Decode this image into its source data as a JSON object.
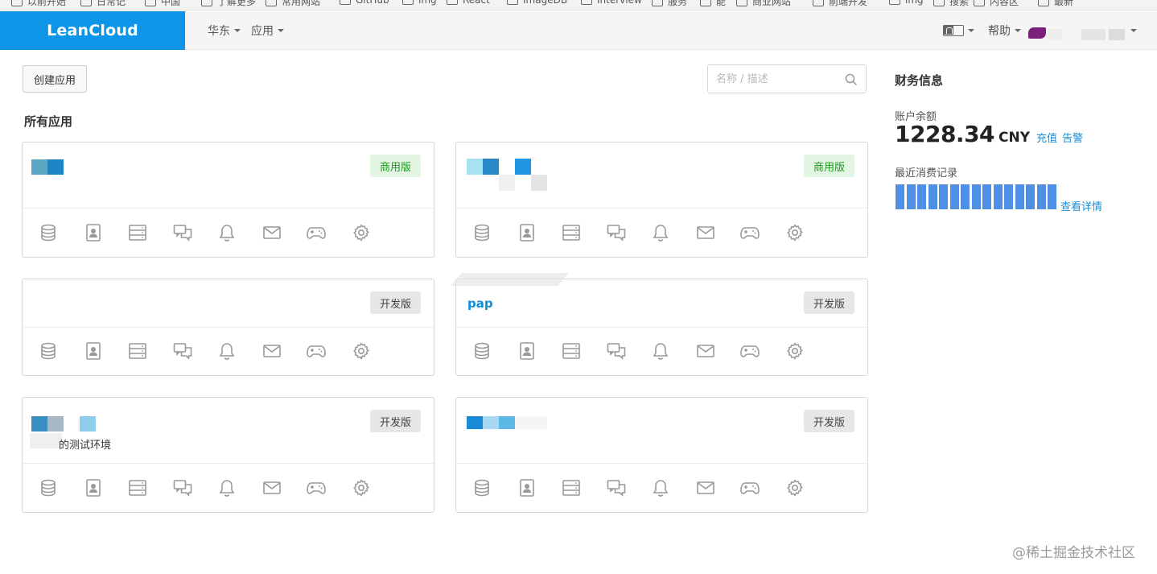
{
  "bookmarks": [
    {
      "label": "以前开始"
    },
    {
      "label": "日常记"
    },
    {
      "label": "中国"
    },
    {
      "label": "了解更多"
    },
    {
      "label": "常用网站"
    },
    {
      "label": "GitHub"
    },
    {
      "label": "img"
    },
    {
      "label": "React"
    },
    {
      "label": "ImageDB"
    },
    {
      "label": "Interview"
    },
    {
      "label": "服务"
    },
    {
      "label": "能"
    },
    {
      "label": "商业网站"
    },
    {
      "label": "前端开发"
    },
    {
      "label": "img"
    },
    {
      "label": "搜索"
    },
    {
      "label": "内容区"
    },
    {
      "label": "最新"
    }
  ],
  "header": {
    "logo": "LeanCloud",
    "region": "华东",
    "apps_menu": "应用",
    "help": "帮助",
    "lang_icon": "translate-icon"
  },
  "toolbar": {
    "create_label": "创建应用",
    "search_placeholder": "名称 / 描述"
  },
  "section_title": "所有应用",
  "cards": [
    {
      "badge": "商用版",
      "badge_type": "biz",
      "name": ""
    },
    {
      "badge": "商用版",
      "badge_type": "biz",
      "name": ""
    },
    {
      "badge": "开发版",
      "badge_type": "dev",
      "name": ""
    },
    {
      "badge": "开发版",
      "badge_type": "dev",
      "name": "pap"
    },
    {
      "badge": "开发版",
      "badge_type": "dev",
      "name": "的测试环境"
    },
    {
      "badge": "开发版",
      "badge_type": "dev",
      "name": ""
    }
  ],
  "card_icons": [
    "database-icon",
    "contact-card-icon",
    "server-icon",
    "chat-icon",
    "bell-icon",
    "mail-icon",
    "gamepad-icon",
    "gear-icon"
  ],
  "finance": {
    "title": "财务信息",
    "balance_label": "账户余额",
    "balance": "1228.34",
    "currency": "CNY",
    "recharge": "充值",
    "alert": "告警",
    "recent_label": "最近消费记录",
    "detail_link": "查看详情",
    "bar_color": "#4f8fe6",
    "bar_levels": [
      1,
      1,
      1,
      1,
      1,
      1,
      1,
      1,
      1,
      1,
      1,
      1,
      1,
      1,
      1
    ]
  },
  "watermark": "@稀土掘金技术社区",
  "colors": {
    "brand": "#0e95e8",
    "link": "#1a8fd8",
    "biz_badge_bg": "#e3f6e3",
    "biz_badge_text": "#1a9a1a"
  }
}
